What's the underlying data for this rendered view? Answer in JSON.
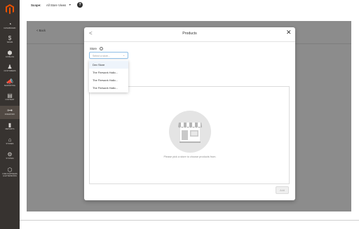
{
  "sidebar": {
    "items": [
      {
        "label": "DASHBOARD",
        "icon": "dashboard-icon",
        "glyph": "◔"
      },
      {
        "label": "SALES",
        "icon": "dollar-icon",
        "glyph": "$"
      },
      {
        "label": "CATALOG",
        "icon": "cube-icon",
        "glyph": "⬢"
      },
      {
        "label": "CUSTOMERS",
        "icon": "person-icon",
        "glyph": "♟"
      },
      {
        "label": "MARKETING",
        "icon": "megaphone-icon",
        "glyph": "📣"
      },
      {
        "label": "CONTENT",
        "icon": "content-icon",
        "glyph": "▤"
      },
      {
        "label": "FIREWORK",
        "icon": "firework-icon",
        "glyph": "⊶"
      },
      {
        "label": "REPORTS",
        "icon": "bar-chart-icon",
        "glyph": "▮"
      },
      {
        "label": "STORES",
        "icon": "store-icon",
        "glyph": "⌂"
      },
      {
        "label": "SYSTEM",
        "icon": "gear-icon",
        "glyph": "⚙"
      },
      {
        "label": "FIND PARTNERS",
        "label2": "& EXTENSIONS",
        "icon": "extensions-icon",
        "glyph": "⬡"
      }
    ],
    "active_index": 6
  },
  "topbar": {
    "scope_label": "Scope:",
    "scope_value": "All Store Views",
    "scope_caret": "▼",
    "help_glyph": "?"
  },
  "page": {
    "back_label": "Back",
    "back_glyph": "<"
  },
  "modal": {
    "back_glyph": "<",
    "title": "Products",
    "close_glyph": "✕",
    "store_label": "Store",
    "info_glyph": "i",
    "store_placeholder": "Select a store...",
    "select_caret": "⌄",
    "store_options": [
      "Dev Store",
      "The Firework Hallo...",
      "The Firework Hallo...",
      "The Firework Hallo..."
    ],
    "hovered_option": 0,
    "empty_message": "Please pick a store to choose products from.",
    "add_label": "Add"
  },
  "colors": {
    "sidebar_bg": "#373330",
    "logo": "#eb5202",
    "overlay": "#8c8c8c",
    "illustration_bg": "#e4e4e4",
    "select_border": "#8fbfe6"
  }
}
